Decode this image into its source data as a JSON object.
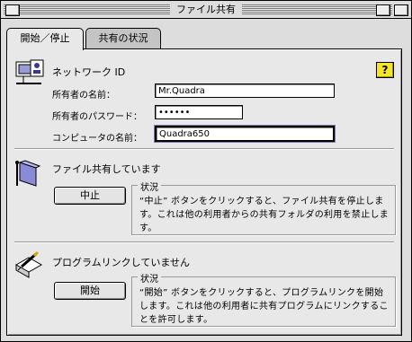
{
  "window": {
    "title": "ファイル共有"
  },
  "tabs": [
    {
      "label": "開始／停止"
    },
    {
      "label": "共有の状況"
    }
  ],
  "network_id": {
    "heading": "ネットワーク ID",
    "owner_name_label": "所有者の名前：",
    "owner_name_value": "Mr.Quadra",
    "owner_password_label": "所有者のパスワード：",
    "owner_password_value": "••••••",
    "computer_name_label": "コンピュータの名前：",
    "computer_name_value": "Quadra650"
  },
  "file_sharing": {
    "heading": "ファイル共有しています",
    "button_label": "中止",
    "status_title": "状況",
    "status_text": "“中止” ボタンをクリックすると、ファイル共有を停止します。これは他の利用者からの共有フォルダの利用を禁止します。"
  },
  "program_linking": {
    "heading": "プログラムリンクしていません",
    "button_label": "開始",
    "status_title": "状況",
    "status_text": "“開始” ボタンをクリックすると、プログラムリンクを開始します。これは他の利用者に共有プログラムにリンクすることを許可します。"
  },
  "help": {
    "label": "?"
  },
  "colors": {
    "help_button": "#f4e52c",
    "window_bg": "#dddddd",
    "panel_bg": "#e8e8e8"
  },
  "icons": [
    "close-box-icon",
    "zoom-box-icon",
    "collapse-box-icon",
    "network-identity-icon",
    "file-sharing-folder-icon",
    "program-linking-icon",
    "help-icon"
  ]
}
